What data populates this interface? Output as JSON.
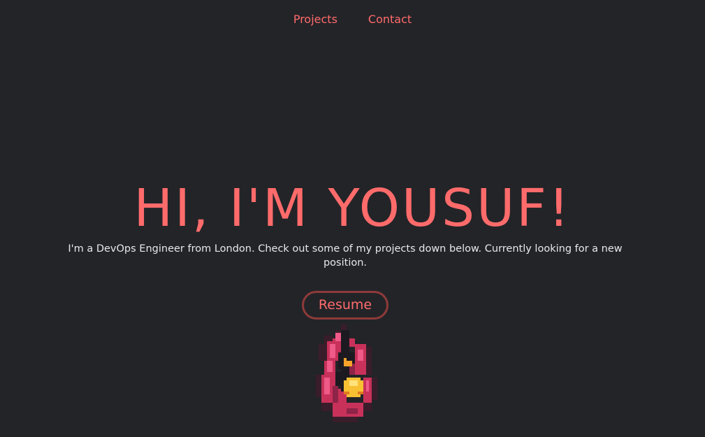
{
  "nav": {
    "items": [
      {
        "label": "Projects"
      },
      {
        "label": "Contact"
      }
    ]
  },
  "hero": {
    "title": "HI, I'M YOUSUF!",
    "subtitle": "I'm a DevOps Engineer from London. Check out some of my projects down below. Currently looking for a new position.",
    "resume_label": "Resume"
  },
  "colors": {
    "background": "#232428",
    "accent": "#ff6b6b",
    "button_border": "#8e3a3a",
    "text": "#e8e8ea"
  },
  "icons": {
    "mascot": "pixel-flame-creature-icon"
  }
}
